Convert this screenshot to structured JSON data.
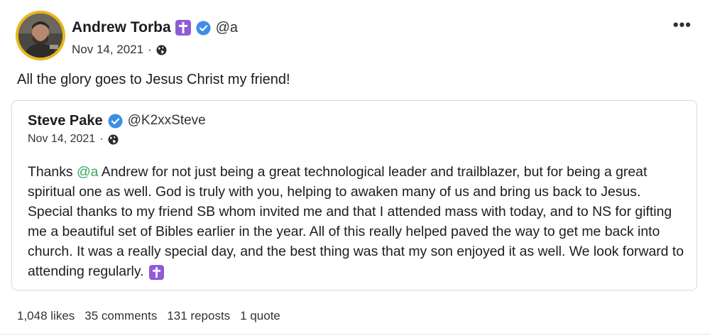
{
  "post": {
    "author_name": "Andrew Torba",
    "author_handle": "@a",
    "date": "Nov 14, 2021",
    "separator": "·",
    "more_label": "•••",
    "text": "All the glory goes to Jesus Christ my friend!"
  },
  "quote": {
    "author_name": "Steve Pake",
    "author_handle": "@K2xxSteve",
    "date": "Nov 14, 2021",
    "separator": "·",
    "body_prefix": "Thanks ",
    "mention": "@a",
    "body_rest": " Andrew for not just being a great technological leader and trailblazer, but for being a great spiritual one as well. God is truly with you, helping to awaken many of us and bring us back to Jesus. Special thanks to my friend SB whom invited me and that I attended mass with today, and to NS for gifting me a beautiful set of Bibles earlier in the year. All of this really helped paved the way to get me back into church. It was a really special day, and the best thing was that my son enjoyed it as well. We look forward to attending regularly. "
  },
  "stats": {
    "likes": "1,048 likes",
    "comments": "35 comments",
    "reposts": "131 reposts",
    "quotes": "1 quote"
  },
  "colors": {
    "mention": "#3aa757",
    "verified": "#3d8ee8",
    "cross_badge": "#8f5bd8",
    "avatar_ring": "#e8b619"
  },
  "icons": [
    "avatar",
    "latin-cross-icon",
    "verified-check-icon",
    "globe-icon",
    "more-options-icon"
  ]
}
